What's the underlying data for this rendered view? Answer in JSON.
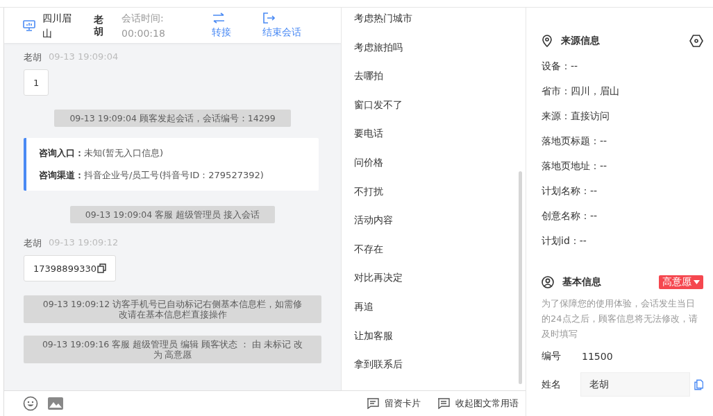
{
  "header": {
    "location": "四川眉山",
    "customer": "老胡",
    "duration_label": "会话时间:",
    "duration": "00:00:18",
    "actions": [
      {
        "kind": "transfer",
        "label": "转接"
      },
      {
        "kind": "end",
        "label": "结束会话"
      }
    ]
  },
  "messages": [
    {
      "kind": "customer",
      "name": "老胡",
      "time": "09-13 19:09:04",
      "text": "1",
      "copyable": false
    },
    {
      "kind": "system",
      "text": "09-13 19:09:04 顾客发起会话，会话编号：14299"
    },
    {
      "kind": "info",
      "rows": [
        {
          "label": "咨询入口：",
          "value": "未知(暂无入口信息)"
        },
        {
          "label": "咨询渠道：",
          "value": "抖音企业号/员工号(抖音号ID：279527392)"
        }
      ]
    },
    {
      "kind": "system",
      "text": "09-13 19:09:04 客服 超级管理员 接入会话"
    },
    {
      "kind": "customer",
      "name": "老胡",
      "time": "09-13 19:09:12",
      "text": "17398899330",
      "copyable": true
    },
    {
      "kind": "system",
      "text": "09-13 19:09:12 访客手机号已自动标记右侧基本信息栏，如需修改请在基本信息栏直接操作"
    },
    {
      "kind": "system",
      "text": "09-13 19:09:16 客服 超级管理员 编辑 顾客状态 ： 由 未标记 改为 高意愿"
    }
  ],
  "phrases": [
    "考虑热门城市",
    "考虑旅拍吗",
    "去哪拍",
    "窗口发不了",
    "要电话",
    "问价格",
    "不打扰",
    "活动内容",
    "不存在",
    "对比再决定",
    "再追",
    "让加客服",
    "拿到联系后"
  ],
  "toolbar": [
    {
      "kind": "card",
      "label": "留资卡片"
    },
    {
      "kind": "collapse",
      "label": "收起图文常用语"
    }
  ],
  "source": {
    "title": "来源信息",
    "rows": [
      "设备：--",
      "省市：四川，眉山",
      "来源：直接访问",
      "落地页标题：--",
      "落地页地址：--",
      "计划名称：--",
      "创意名称：--",
      "计划id：--"
    ]
  },
  "basic": {
    "title": "基本信息",
    "status": {
      "label": "高意愿",
      "color": "#f5474f"
    },
    "note": "为了保障您的使用体验，会话发生当日的24点之后，顾客信息将无法修改，请及时填写",
    "fields": [
      {
        "kind": "text",
        "label": "编号",
        "value": "11500"
      },
      {
        "kind": "input",
        "label": "姓名",
        "value": "老胡"
      }
    ]
  }
}
